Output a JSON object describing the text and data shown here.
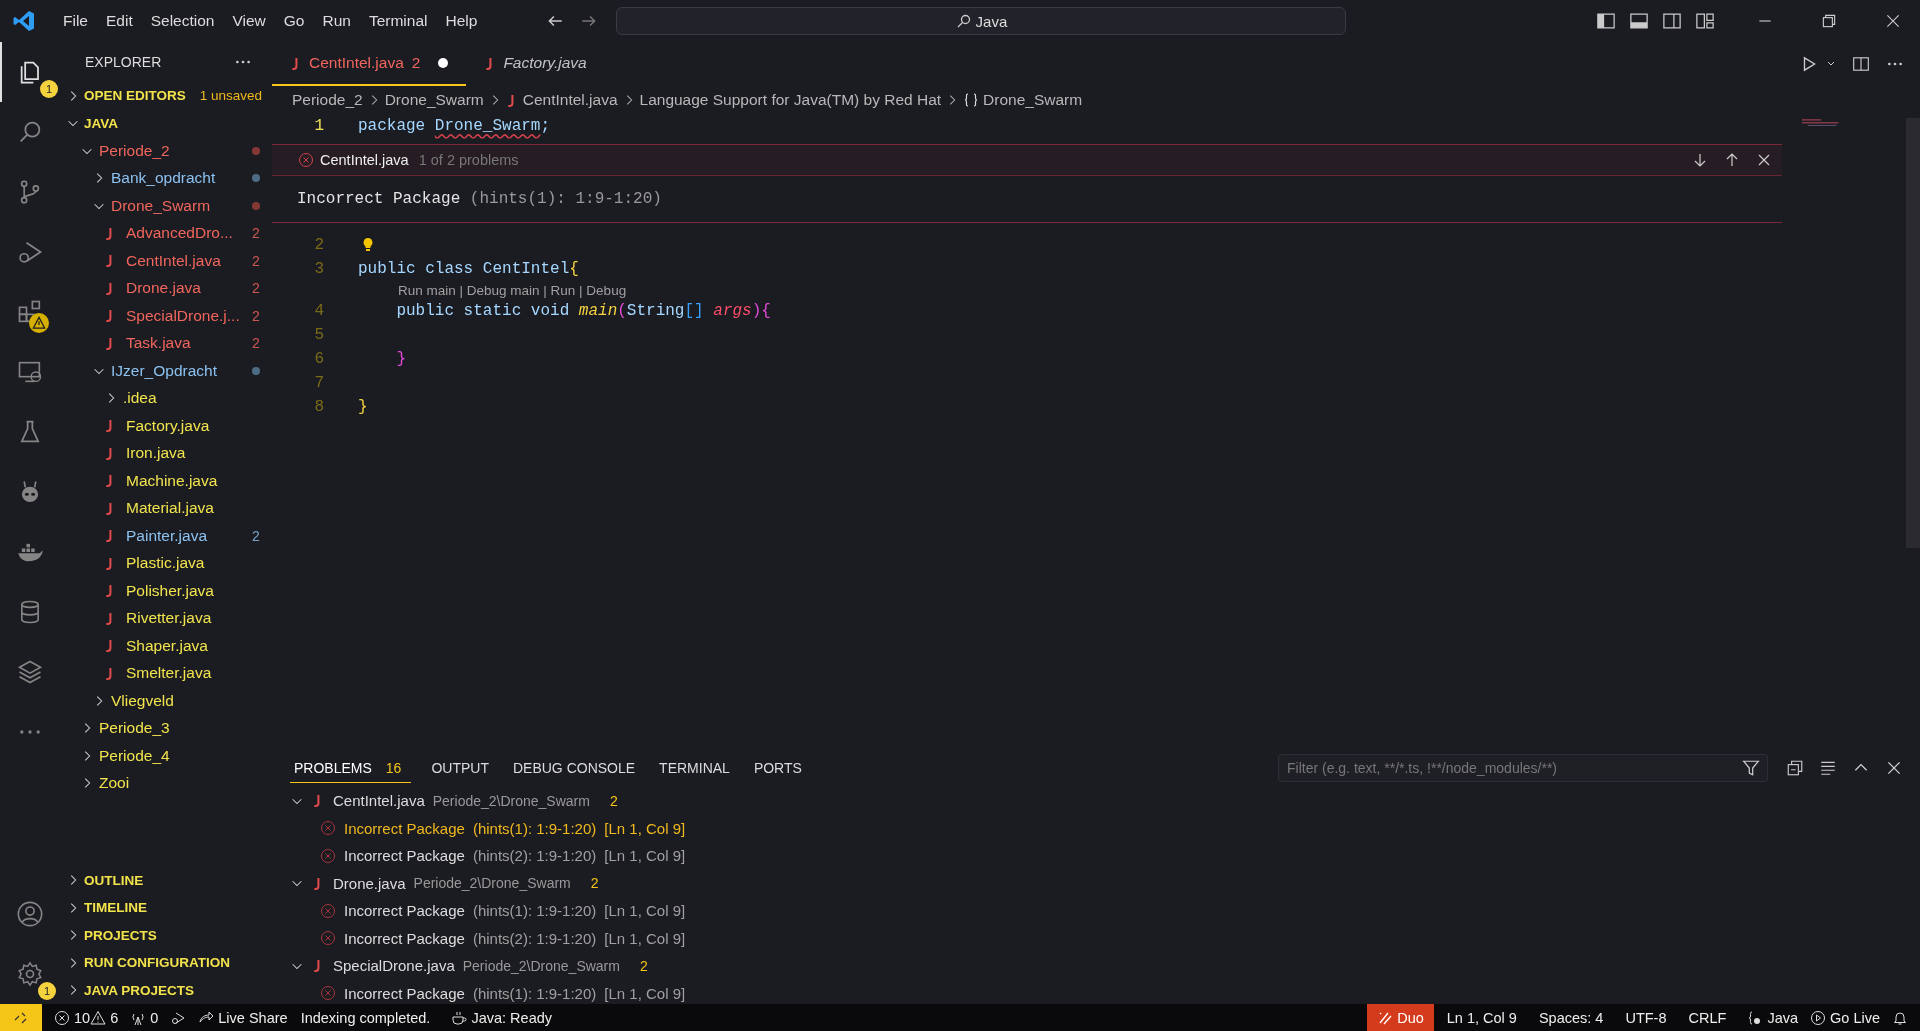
{
  "menu": [
    "File",
    "Edit",
    "Selection",
    "View",
    "Go",
    "Run",
    "Terminal",
    "Help"
  ],
  "command_center": {
    "label": "Java"
  },
  "activity_bar": [
    {
      "selected": true,
      "badge": "1"
    },
    {
      "selected": false
    },
    {
      "selected": false
    },
    {
      "selected": false
    },
    {
      "selected": false,
      "warning": true
    },
    {
      "selected": false
    },
    {
      "selected": false
    },
    {
      "selected": false
    },
    {
      "selected": false
    },
    {
      "selected": false
    },
    {
      "selected": false
    },
    {
      "selected": false
    }
  ],
  "settings_badge": "1",
  "explorer": {
    "title": "EXPLORER",
    "open_editors": {
      "label": "OPEN EDITORS",
      "note": "1 unsaved",
      "expanded": false
    },
    "root": {
      "label": "JAVA",
      "expanded": true,
      "children": [
        {
          "name": "Periode_2",
          "color": "#f0665c",
          "dot": true,
          "expanded": true,
          "children": [
            {
              "name": "Bank_opdracht",
              "color": "#8cc2f0",
              "dot": true,
              "expanded": false
            },
            {
              "name": "Drone_Swarm",
              "color": "#f0665c",
              "dot": true,
              "expanded": true,
              "children": [
                {
                  "name": "AdvancedDro...",
                  "color": "#f0665c",
                  "badge": "2"
                },
                {
                  "name": "CentIntel.java",
                  "color": "#f0665c",
                  "badge": "2"
                },
                {
                  "name": "Drone.java",
                  "color": "#f0665c",
                  "badge": "2"
                },
                {
                  "name": "SpecialDrone.j...",
                  "color": "#f0665c",
                  "badge": "2"
                },
                {
                  "name": "Task.java",
                  "color": "#f0665c",
                  "badge": "2"
                }
              ]
            },
            {
              "name": "IJzer_Opdracht",
              "color": "#8cc2f0",
              "dot": true,
              "expanded": true,
              "children": [
                {
                  "name": ".idea",
                  "color": "#f1e44d",
                  "expanded": false
                },
                {
                  "name": "Factory.java",
                  "color": "#f1e44d"
                },
                {
                  "name": "Iron.java",
                  "color": "#f1e44d"
                },
                {
                  "name": "Machine.java",
                  "color": "#f1e44d"
                },
                {
                  "name": "Material.java",
                  "color": "#f1e44d"
                },
                {
                  "name": "Painter.java",
                  "color": "#8cc2f0",
                  "badge": "2"
                },
                {
                  "name": "Plastic.java",
                  "color": "#f1e44d"
                },
                {
                  "name": "Polisher.java",
                  "color": "#f1e44d"
                },
                {
                  "name": "Rivetter.java",
                  "color": "#f1e44d"
                },
                {
                  "name": "Shaper.java",
                  "color": "#f1e44d"
                },
                {
                  "name": "Smelter.java",
                  "color": "#f1e44d"
                }
              ]
            },
            {
              "name": "Vliegveld",
              "color": "#f1e44d",
              "expanded": false
            }
          ]
        },
        {
          "name": "Periode_3",
          "color": "#f1e44d",
          "expanded": false
        },
        {
          "name": "Periode_4",
          "color": "#f1e44d",
          "expanded": false
        },
        {
          "name": "Zooi",
          "color": "#f1e44d",
          "expanded": false
        }
      ]
    },
    "sections": [
      {
        "label": "OUTLINE",
        "expanded": false
      },
      {
        "label": "TIMELINE",
        "expanded": false
      },
      {
        "label": "PROJECTS",
        "expanded": false
      },
      {
        "label": "RUN CONFIGURATION",
        "expanded": false
      },
      {
        "label": "JAVA PROJECTS",
        "expanded": false
      }
    ]
  },
  "tabs": [
    {
      "label": "CentIntel.java",
      "badge": "2",
      "modified": true,
      "preview": false,
      "color": "#f0665c",
      "selected": true
    },
    {
      "label": "Factory.java",
      "modified": false,
      "preview": true,
      "color": "#c2c2c2",
      "selected": false
    }
  ],
  "breadcrumb": [
    {
      "label": "Periode_2"
    },
    {
      "label": "Drone_Swarm"
    },
    {
      "label": "CentIntel.java",
      "kind": "java"
    },
    {
      "label": "Language Support for Java(TM) by Red Hat"
    },
    {
      "label": "Drone_Swarm",
      "kind": "braces"
    }
  ],
  "editor": {
    "lines": [
      {
        "kind": "code",
        "number": "1",
        "current": true,
        "tokens": [
          {
            "text": "package ",
            "kind": "keyword"
          },
          {
            "text": "Drone_Swarm",
            "kind": "error"
          },
          {
            "text": ";",
            "kind": "plain"
          }
        ]
      },
      {
        "kind": "peek",
        "file": "CentIntel.java",
        "count": "1 of 2 problems",
        "message": "Incorrect Package",
        "hint": "(hints(1): 1:9-1:20)"
      },
      {
        "kind": "code",
        "number": "2",
        "current": false,
        "lightbulb": true
      },
      {
        "kind": "code",
        "number": "3",
        "current": false,
        "tokens": [
          {
            "text": "public class ",
            "kind": "keyword"
          },
          {
            "text": "CentIntel",
            "kind": "plain"
          },
          {
            "text": "{",
            "kind": "bracket1"
          }
        ]
      },
      {
        "kind": "codelens",
        "text": "Run main | Debug main | Run | Debug"
      },
      {
        "kind": "code",
        "number": "4",
        "current": false,
        "tokens": [
          {
            "text": "    public static void ",
            "kind": "keyword"
          },
          {
            "text": "main",
            "kind": "function"
          },
          {
            "text": "(",
            "kind": "bracket2"
          },
          {
            "text": "String",
            "kind": "plain"
          },
          {
            "text": "[]",
            "kind": "bracket3"
          },
          {
            "text": " args",
            "kind": "param"
          },
          {
            "text": ")",
            "kind": "bracket2"
          },
          {
            "text": "{",
            "kind": "bracket2"
          }
        ]
      },
      {
        "kind": "code",
        "number": "5",
        "current": false
      },
      {
        "kind": "code",
        "number": "6",
        "current": false,
        "tokens": [
          {
            "text": "    }",
            "kind": "bracket2"
          }
        ]
      },
      {
        "kind": "code",
        "number": "7",
        "current": false
      },
      {
        "kind": "code",
        "number": "8",
        "current": false,
        "tokens": [
          {
            "text": "}",
            "kind": "bracket1"
          }
        ]
      }
    ]
  },
  "panel": {
    "tabs": [
      {
        "label": "PROBLEMS",
        "count": "16",
        "selected": true
      },
      {
        "label": "OUTPUT",
        "selected": false
      },
      {
        "label": "DEBUG CONSOLE",
        "selected": false
      },
      {
        "label": "TERMINAL",
        "selected": false
      },
      {
        "label": "PORTS",
        "selected": false
      }
    ],
    "filter": {
      "placeholder": "Filter (e.g. text, **/*.ts, !**/node_modules/**)"
    },
    "groups": [
      {
        "file": "CentIntel.java",
        "path": "Periode_2\\Drone_Swarm",
        "count": "2",
        "expanded": true,
        "problems": [
          {
            "message": "Incorrect Package",
            "hint": "(hints(1): 1:9-1:20)",
            "location": "[Ln 1, Col 9]",
            "selected": true
          },
          {
            "message": "Incorrect Package",
            "hint": "(hints(2): 1:9-1:20)",
            "location": "[Ln 1, Col 9]",
            "selected": false
          }
        ]
      },
      {
        "file": "Drone.java",
        "path": "Periode_2\\Drone_Swarm",
        "count": "2",
        "expanded": true,
        "problems": [
          {
            "message": "Incorrect Package",
            "hint": "(hints(1): 1:9-1:20)",
            "location": "[Ln 1, Col 9]",
            "selected": false
          },
          {
            "message": "Incorrect Package",
            "hint": "(hints(2): 1:9-1:20)",
            "location": "[Ln 1, Col 9]",
            "selected": false
          }
        ]
      },
      {
        "file": "SpecialDrone.java",
        "path": "Periode_2\\Drone_Swarm",
        "count": "2",
        "expanded": true,
        "problems": [
          {
            "message": "Incorrect Package",
            "hint": "(hints(1): 1:9-1:20)",
            "location": "[Ln 1, Col 9]",
            "selected": false
          }
        ]
      }
    ]
  },
  "status_bar": {
    "left": [
      {
        "kind": "remote"
      },
      {
        "kind": "errors",
        "text": "10"
      },
      {
        "kind": "warnings",
        "text": "6"
      },
      {
        "kind": "ports",
        "text": "0"
      },
      {
        "kind": "debug"
      },
      {
        "kind": "liveshare",
        "text": "Live Share"
      },
      {
        "kind": "text",
        "text": "Indexing completed."
      },
      {
        "kind": "java",
        "text": "Java: Ready"
      }
    ],
    "right": [
      {
        "kind": "duo",
        "text": "Duo"
      },
      {
        "kind": "text",
        "text": "Ln 1, Col 9"
      },
      {
        "kind": "text",
        "text": "Spaces: 4"
      },
      {
        "kind": "text",
        "text": "UTF-8"
      },
      {
        "kind": "text",
        "text": "CRLF"
      },
      {
        "kind": "language",
        "text": "Java"
      },
      {
        "kind": "golive",
        "text": "Go Live"
      },
      {
        "kind": "bell"
      }
    ]
  }
}
